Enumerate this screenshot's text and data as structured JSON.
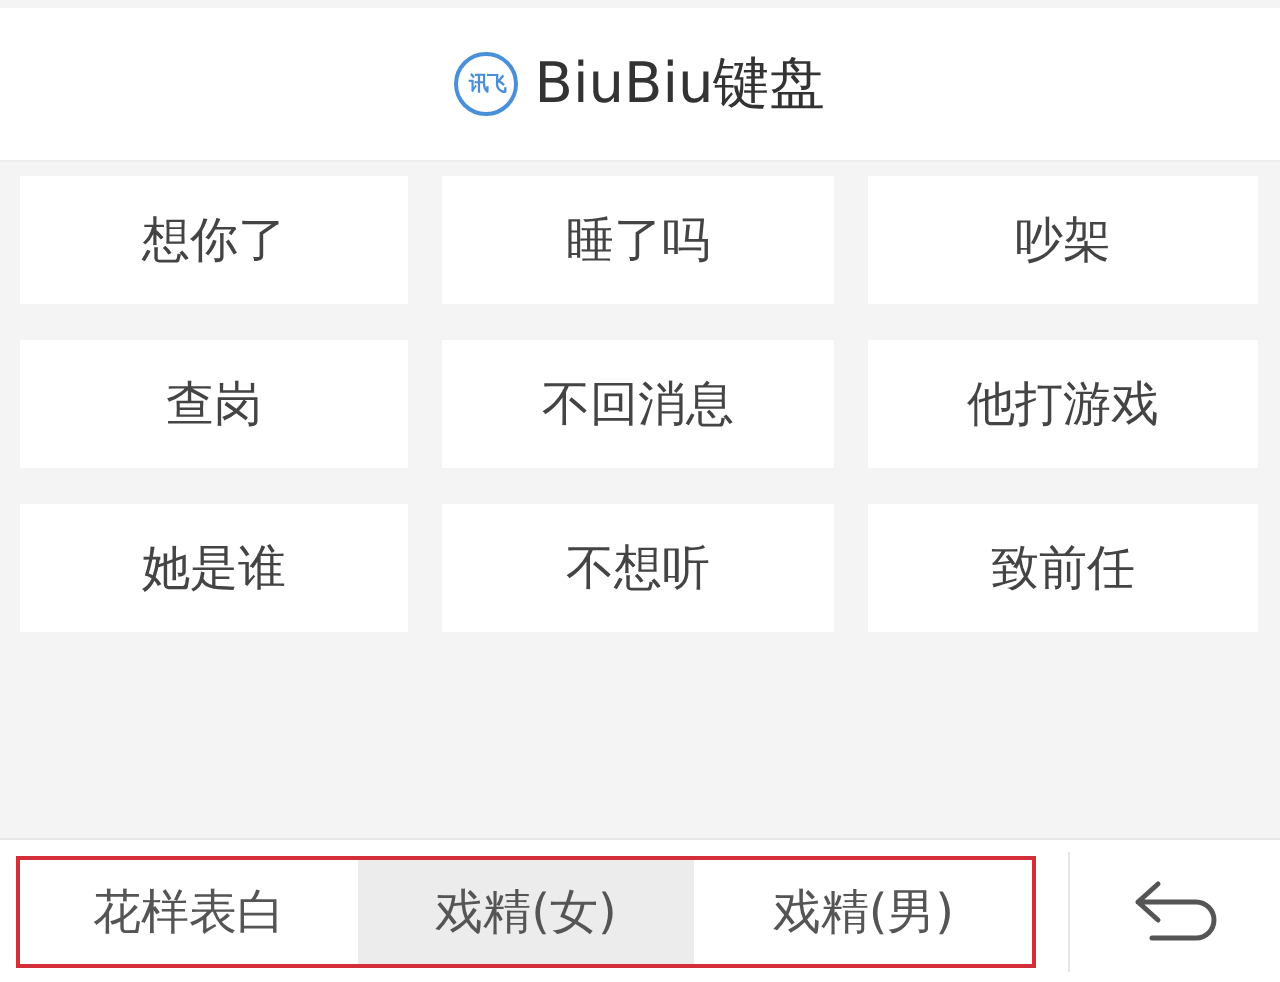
{
  "header": {
    "logo_text": "讯飞",
    "title": "BiuBiu键盘"
  },
  "phrases": [
    "想你了",
    "睡了吗",
    "吵架",
    "查岗",
    "不回消息",
    "他打游戏",
    "她是谁",
    "不想听",
    "致前任"
  ],
  "tabs": [
    {
      "label": "花样表白",
      "selected": false
    },
    {
      "label": "戏精(女)",
      "selected": true
    },
    {
      "label": "戏精(男)",
      "selected": false
    }
  ]
}
